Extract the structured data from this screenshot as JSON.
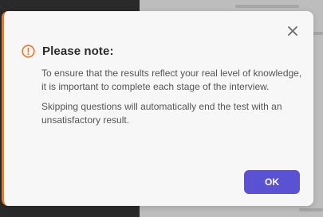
{
  "dialog": {
    "title": "Please note:",
    "title_icon": "exclamation-circle-icon",
    "close_icon": "close-icon",
    "paragraph_1": "To ensure that the results reflect your real level of knowledge, it is important to complete each stage of the interview.",
    "paragraph_2": "Skipping questions will automatically end the test with an unsatisfactory result.",
    "ok_label": "OK"
  },
  "colors": {
    "accent_bar": "#e8792a",
    "warning_icon": "#e8792a",
    "primary_button": "#5a52d3"
  }
}
